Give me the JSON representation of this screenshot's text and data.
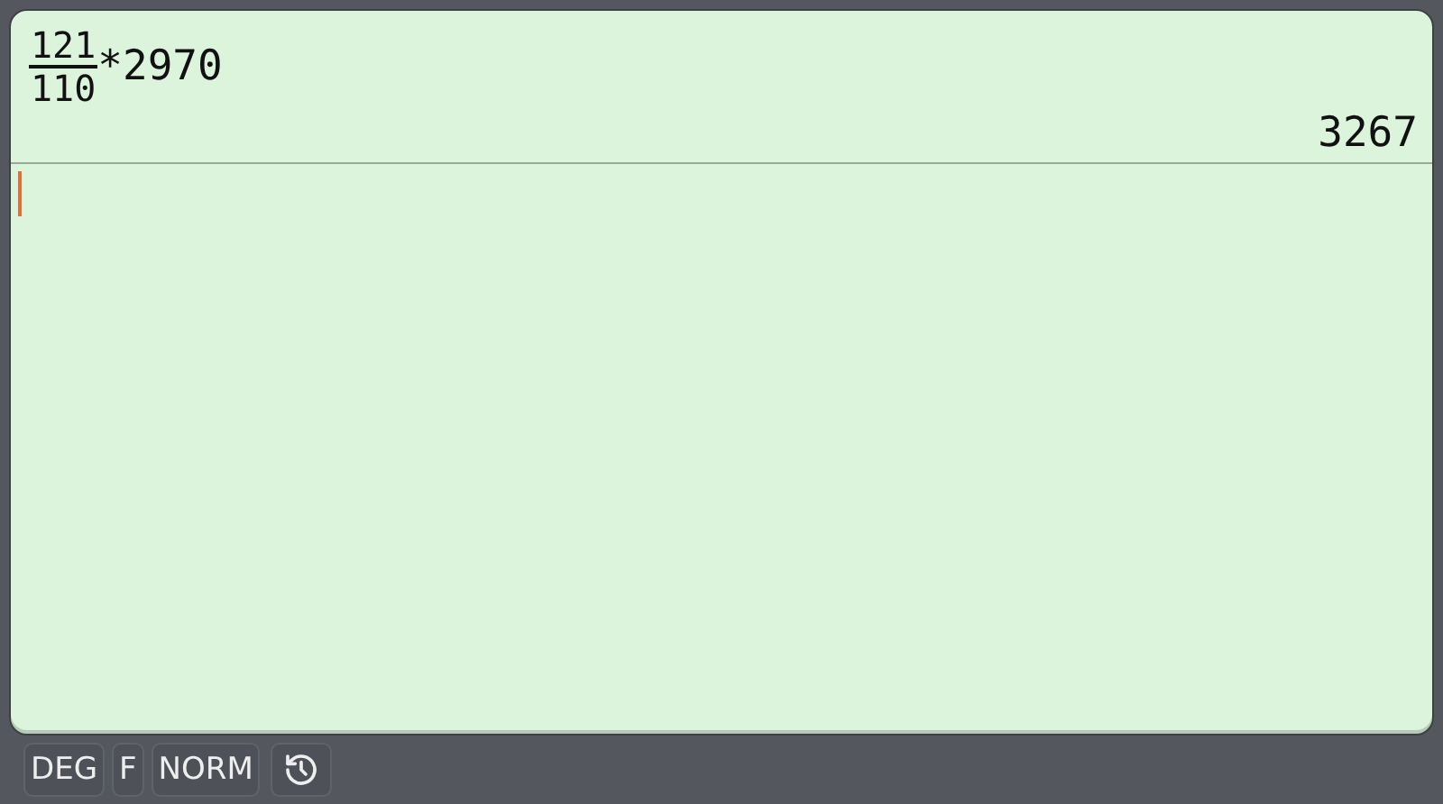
{
  "expression": {
    "numerator": "121",
    "denominator": "110",
    "rest": "*2970"
  },
  "result": "3267",
  "input": {
    "cursor": true
  },
  "status_bar": {
    "modes": [
      "DEG",
      "F",
      "NORM"
    ]
  }
}
